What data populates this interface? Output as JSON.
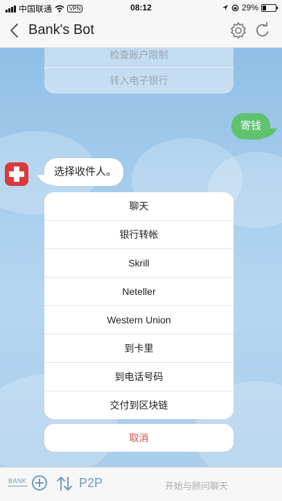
{
  "status_bar": {
    "carrier": "中国联通",
    "vpn": "VPN",
    "time": "08:12",
    "battery": "29%",
    "battery_level": 0.29
  },
  "header": {
    "title": "Bank's Bot"
  },
  "top_menu": {
    "items": [
      "检查账户限制",
      "转入电子银行"
    ]
  },
  "outgoing_message": "寄钱",
  "bot_message": "选择收件人。",
  "options": [
    "聊天",
    "银行转帐",
    "Skrill",
    "Neteller",
    "Western Union",
    "到卡里",
    "到电话号码",
    "交付到区块链"
  ],
  "cancel_label": "取消",
  "bottom_bar": {
    "bank_label": "BANK",
    "p2p_label": "P2P",
    "input_placeholder": "开始与顾问聊天"
  },
  "colors": {
    "accent": "#6b9ac4",
    "outgoing_bubble": "#5fc26e",
    "cancel": "#e0494a",
    "avatar": "#d83b3b"
  }
}
